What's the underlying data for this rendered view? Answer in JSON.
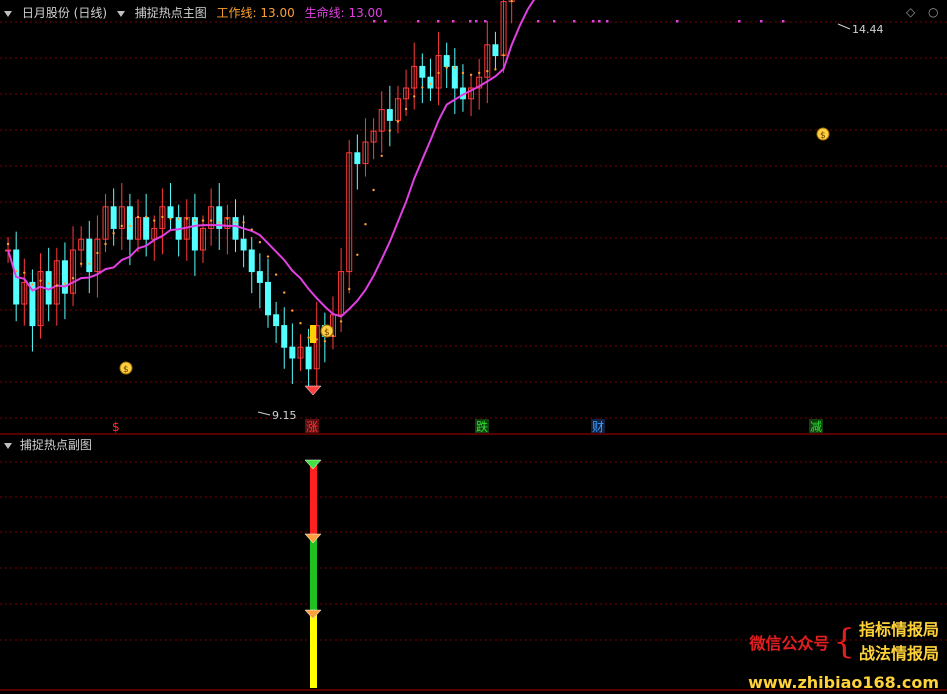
{
  "main_panel": {
    "stock_name": "日月股份",
    "period": "(日线)",
    "indicator_name": "捕捉热点主图",
    "work_line_label": "工作线: 13.00",
    "life_line_label": "生命线: 13.00",
    "high_label": "14.44",
    "low_label": "9.15",
    "signals": [
      {
        "text": "$",
        "color": "#ff3030"
      },
      {
        "text": "涨",
        "color": "#ff3030",
        "bg": "#5a1010"
      },
      {
        "text": "跌",
        "color": "#30e030",
        "bg": "#104010"
      },
      {
        "text": "财",
        "color": "#3aa0ff",
        "bg": "#102040"
      },
      {
        "text": "减",
        "color": "#30e030",
        "bg": "#104010"
      }
    ],
    "controls": {
      "left_icon": "diamond-icon",
      "right_icon": "close-icon"
    }
  },
  "sub_panel": {
    "indicator_name": "捕捉热点副图"
  },
  "watermark": {
    "left_text": "微信公众号",
    "right_line1": "指标情报局",
    "right_line2": "战法情报局",
    "url": "www.zhibiao168.com"
  },
  "colors": {
    "up": "#ff3b3b",
    "down": "#55ffff",
    "life_line": "#e040e0",
    "work_line": "#ffa030",
    "grid": "#7a0000"
  }
}
